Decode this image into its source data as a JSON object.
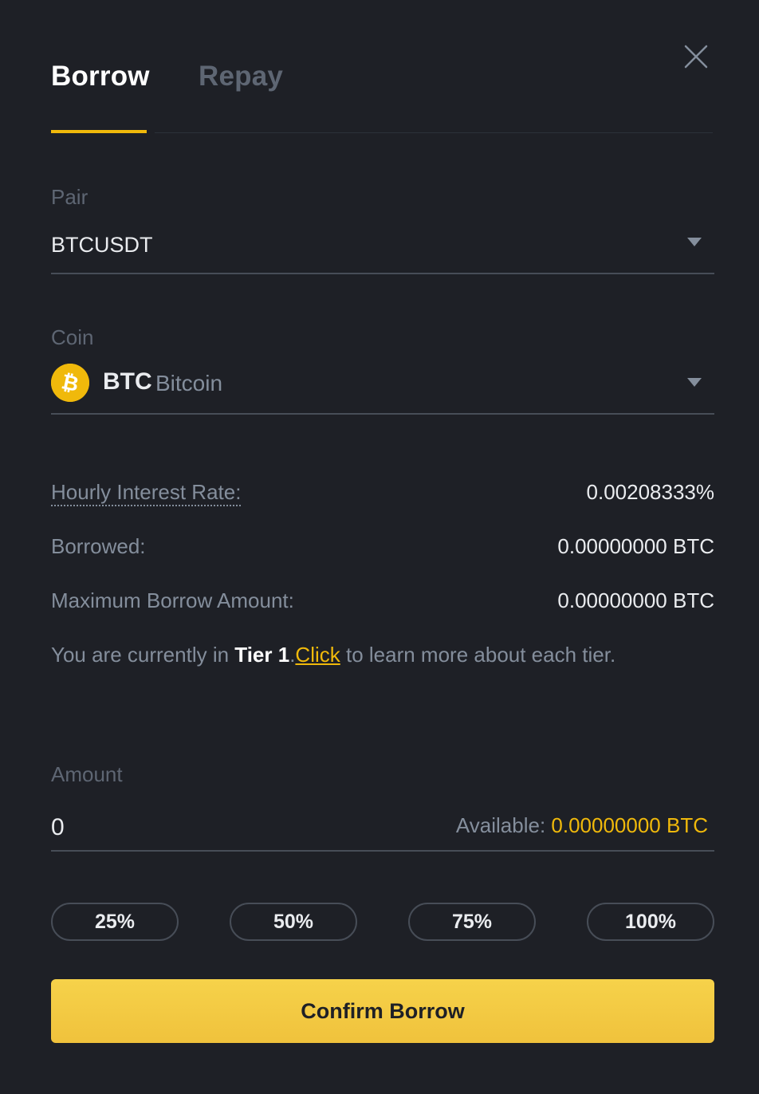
{
  "tabs": [
    {
      "label": "Borrow",
      "active": true
    },
    {
      "label": "Repay",
      "active": false
    }
  ],
  "pair": {
    "label": "Pair",
    "value": "BTCUSDT"
  },
  "coin": {
    "label": "Coin",
    "symbol": "BTC",
    "name": "Bitcoin",
    "icon": "bitcoin-icon",
    "icon_color": "#f0b90b"
  },
  "info": {
    "hourly_rate_label": "Hourly Interest Rate:",
    "hourly_rate_value": "0.00208333%",
    "borrowed_label": "Borrowed:",
    "borrowed_value": "0.00000000 BTC",
    "max_label": "Maximum Borrow Amount:",
    "max_value": "0.00000000 BTC"
  },
  "tier": {
    "prefix": "You are currently in ",
    "tier_name": "Tier 1",
    "separator": ".",
    "link_text": "Click",
    "suffix": " to learn more about each tier."
  },
  "amount": {
    "label": "Amount",
    "value": "0",
    "available_label": "Available: ",
    "available_value": "0.00000000 BTC"
  },
  "percent_buttons": [
    "25%",
    "50%",
    "75%",
    "100%"
  ],
  "confirm_label": "Confirm Borrow",
  "colors": {
    "background": "#1e2026",
    "accent": "#f0b90b",
    "text_primary": "#eaecef",
    "text_secondary": "#848e9c"
  }
}
